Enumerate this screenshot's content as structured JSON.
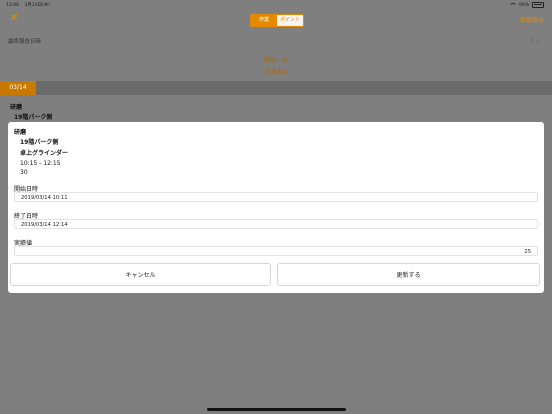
{
  "status_bar": {
    "time": "13:06",
    "date": "3月14日(木)",
    "battery": "99%"
  },
  "header": {
    "segment": [
      "作業",
      "ポイント"
    ],
    "report_link": "実績報告"
  },
  "background": {
    "last_report_label": "最終報告日時",
    "last_report_value": "なし",
    "department": "開発一部",
    "worker": "作業者A",
    "date_tab": "03/14",
    "category": "研磨",
    "site": "19階パーク側"
  },
  "modal": {
    "category": "研磨",
    "site": "19階パーク側",
    "tool": "卓上グラインダー",
    "time_range": "10:15 - 12:15",
    "duration": "30",
    "start_label": "開始日時",
    "start_value": "2019/03/14 10:11",
    "end_label": "終了日時",
    "end_value": "2019/03/14 12:14",
    "actual_label": "実績値",
    "actual_value": "25",
    "cancel_button": "キャンセル",
    "update_button": "更新する"
  },
  "colors": {
    "accent": "#e58a00",
    "overlay": "#7f7f7f"
  },
  "icons": {
    "close": "close-icon",
    "wifi": "wifi-icon",
    "battery": "battery-icon"
  }
}
